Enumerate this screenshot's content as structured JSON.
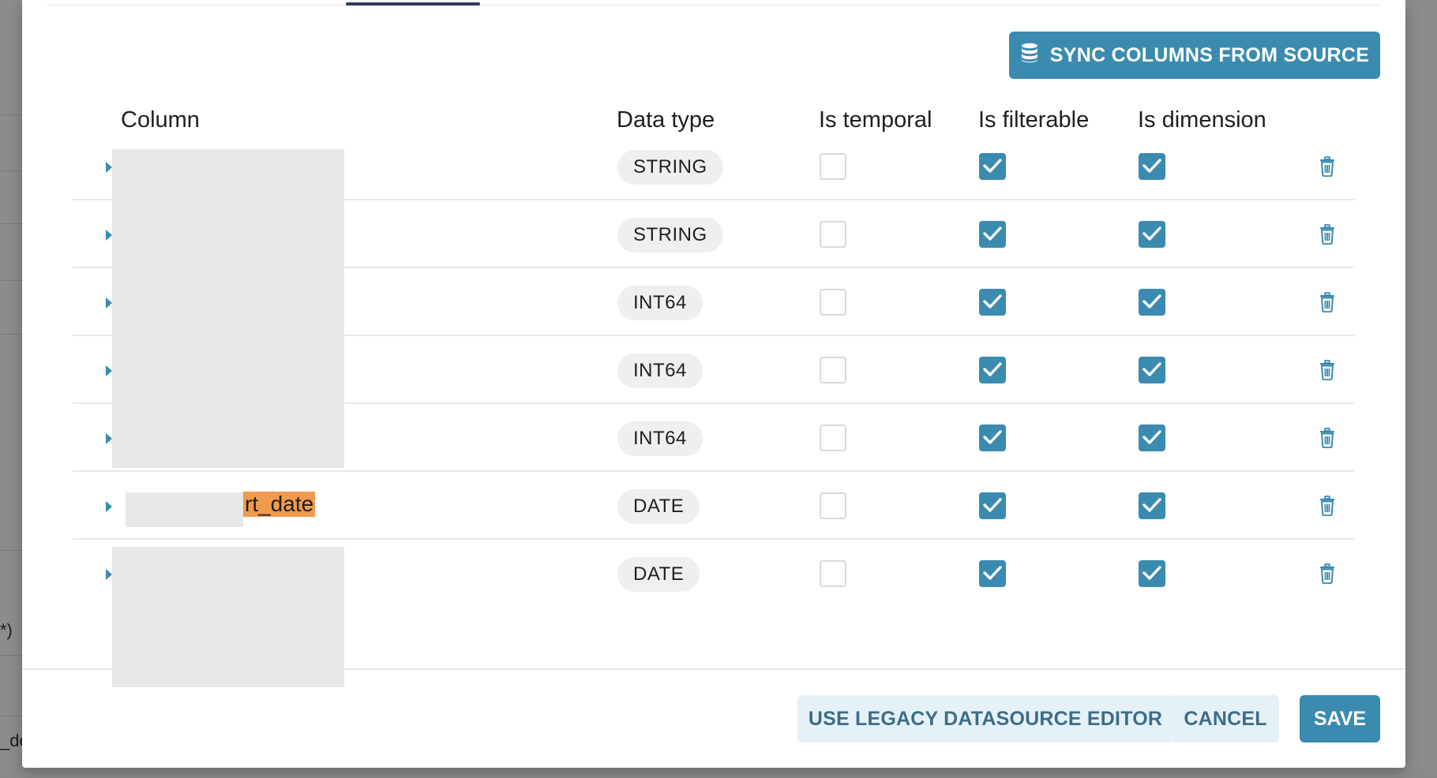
{
  "toolbar": {
    "sync_label": "SYNC COLUMNS FROM SOURCE",
    "sync_icon": "database-icon"
  },
  "table": {
    "headers": {
      "column": "Column",
      "data_type": "Data type",
      "is_temporal": "Is temporal",
      "is_filterable": "Is filterable",
      "is_dimension": "Is dimension"
    },
    "rows": [
      {
        "name": "",
        "type": "STRING",
        "is_temporal": false,
        "is_filterable": true,
        "is_dimension": true
      },
      {
        "name": "",
        "type": "STRING",
        "is_temporal": false,
        "is_filterable": true,
        "is_dimension": true
      },
      {
        "name": "",
        "type": "INT64",
        "is_temporal": false,
        "is_filterable": true,
        "is_dimension": true
      },
      {
        "name": "",
        "type": "INT64",
        "is_temporal": false,
        "is_filterable": true,
        "is_dimension": true
      },
      {
        "name": "",
        "type": "INT64",
        "is_temporal": false,
        "is_filterable": true,
        "is_dimension": true
      },
      {
        "name": "rt_date",
        "type": "DATE",
        "is_temporal": false,
        "is_filterable": true,
        "is_dimension": true
      },
      {
        "name": "",
        "type": "DATE",
        "is_temporal": false,
        "is_filterable": true,
        "is_dimension": true
      }
    ]
  },
  "footer": {
    "legacy_label": "USE LEGACY DATASOURCE EDITOR",
    "cancel_label": "CANCEL",
    "save_label": "SAVE"
  },
  "background": {
    "snippet_1": "*)",
    "snippet_2": "_de"
  },
  "colors": {
    "primary": "#3b8bb0",
    "secondary_bg": "#e5f1f7",
    "highlight": "#f09a4e"
  }
}
